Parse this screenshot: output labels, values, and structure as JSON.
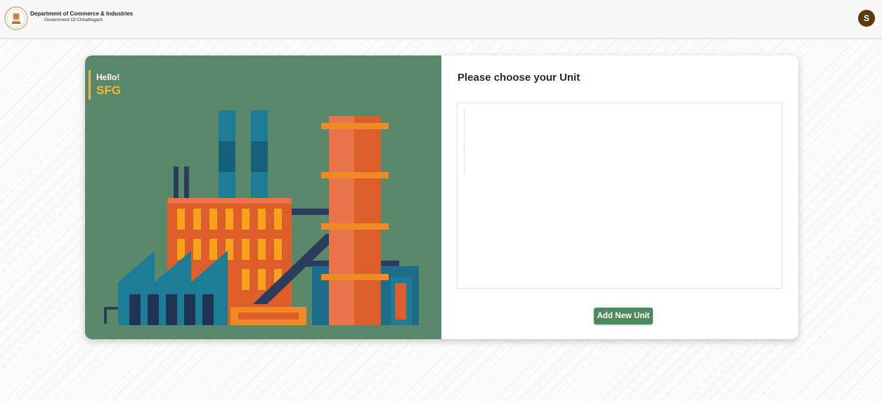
{
  "header": {
    "department": "Department of Commerce & Industries",
    "government": "Government Of Chhattisgarh",
    "avatar_initial": "S",
    "avatar_color": "#5a3c0a"
  },
  "greeting": {
    "hello": "Hello!",
    "user": "SFG"
  },
  "units": {
    "title": "Please choose your Unit",
    "add_label": "Add New Unit"
  },
  "colors": {
    "panel_green": "#5a886a",
    "accent_yellow": "#f3b53e",
    "button_green": "#4f8a5c"
  },
  "icons": {
    "emblem": "state-emblem-icon",
    "illustration": "factory-illustration"
  }
}
